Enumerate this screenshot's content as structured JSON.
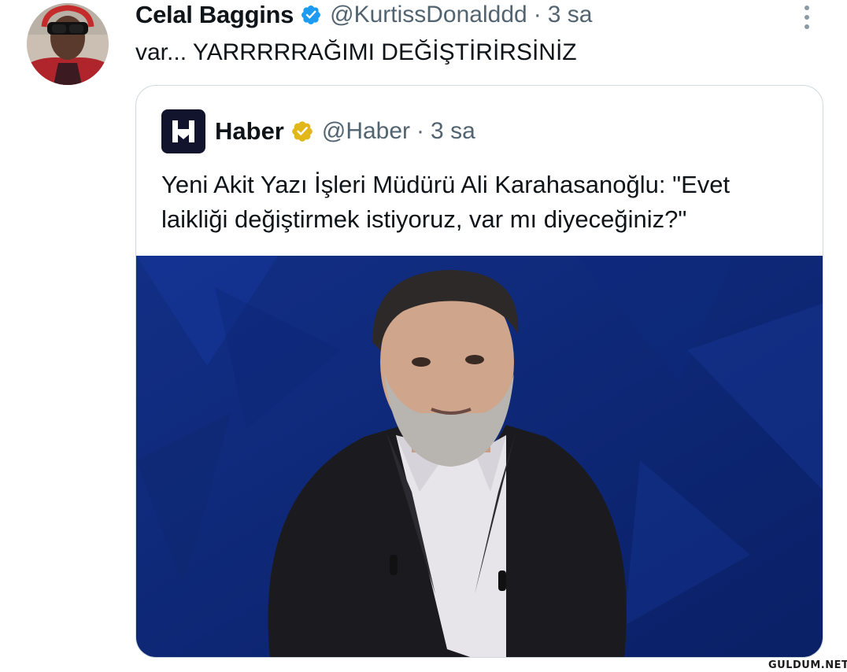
{
  "tweet": {
    "author_name": "Celal Baggins",
    "handle": "@KurtissDonalddd",
    "separator": "·",
    "time": "3 sa",
    "text": "var... YARRRRRAĞIMI DEĞİŞTİRİRSİNİZ"
  },
  "quoted_tweet": {
    "author_name": "Haber",
    "handle": "@Haber",
    "separator": "·",
    "time": "3 sa",
    "text": "Yeni Akit Yazı İşleri Müdürü Ali Karahasanoğlu: \"Evet laikliği değiştirmek istiyoruz, var mı diyeceğiniz?\""
  },
  "icons": {
    "verified_author": "verified-badge-icon",
    "verified_quoted": "gold-verified-badge-icon",
    "more": "more-options-icon",
    "quoted_logo": "haber-logo-icon"
  },
  "colors": {
    "verified_blue": "#1d9bf0",
    "verified_gold": "#e2b719",
    "secondary_text": "#536471",
    "logo_bg": "#12142e",
    "media_bg": "#0e2a7a"
  },
  "watermark": "GULDUM.NET"
}
